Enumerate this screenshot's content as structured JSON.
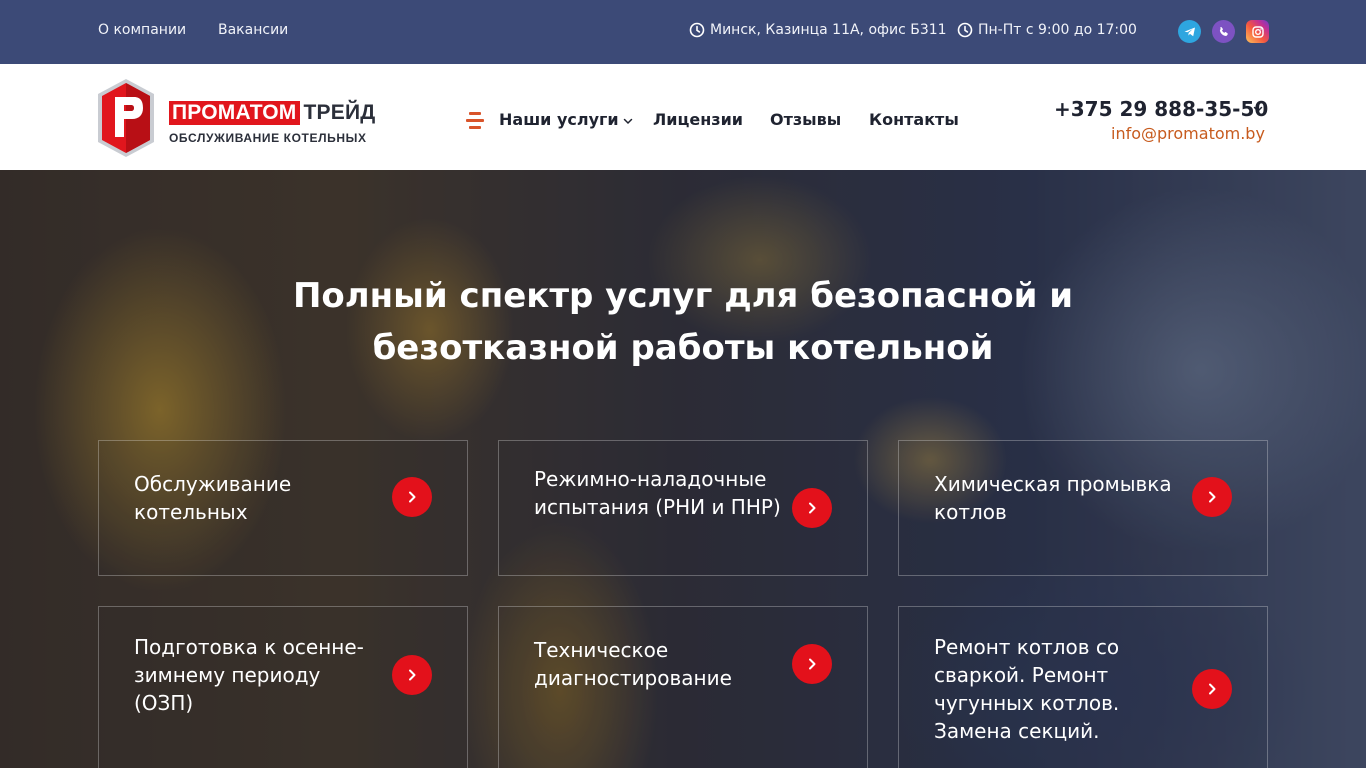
{
  "topbar": {
    "links": [
      "О компании",
      "Вакансии"
    ],
    "address": "Минск, Казинца 11А, офис Б311",
    "hours": "Пн-Пт с 9:00 до 17:00",
    "social": [
      "telegram-icon",
      "viber-icon",
      "instagram-icon"
    ],
    "colors": {
      "background": "#3c4a77"
    }
  },
  "header": {
    "logo": {
      "brand_red": "ПРОМАТОМ",
      "brand_dark": "ТРЕЙД",
      "tagline": "ОБСЛУЖИВАНИЕ КОТЕЛЬНЫХ"
    },
    "nav": [
      "Наши услуги",
      "Лицензии",
      "Отзывы",
      "Контакты"
    ],
    "phone": "+375 29 888-35-50",
    "email": "info@promatom.by",
    "colors": {
      "accent": "#e1161d",
      "email": "#c75b1e"
    }
  },
  "hero": {
    "title_line1": "Полный спектр услуг для безопасной и",
    "title_line2": "безотказной работы котельной",
    "services": [
      "Обслуживание котельных",
      "Режимно-наладочные испытания (РНИ и ПНР)",
      "Химическая промывка котлов",
      "Подготовка к осенне-зимнему периоду (ОЗП)",
      "Техническое диагностирование",
      "Ремонт котлов со сваркой. Ремонт чугунных котлов. Замена секций."
    ],
    "colors": {
      "arrow": "#e3111b"
    }
  }
}
